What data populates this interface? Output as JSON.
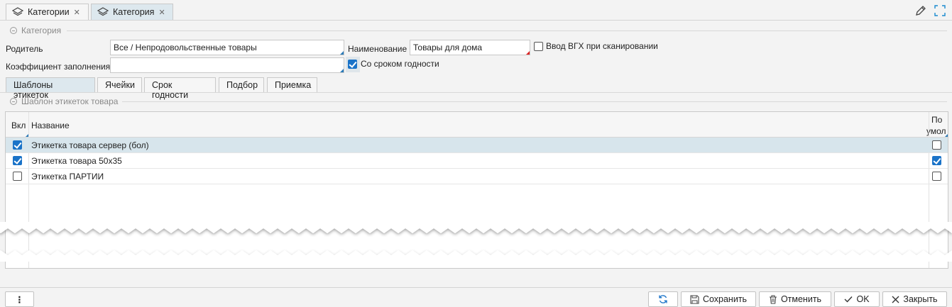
{
  "tabs": [
    {
      "label": "Категории",
      "active": false
    },
    {
      "label": "Категория",
      "active": true
    }
  ],
  "section_main": {
    "title": "Категория"
  },
  "form": {
    "parent_label": "Родитель",
    "parent_value": "Все / Непродовольственные товары",
    "name_label": "Наименование",
    "name_value": "Товары для дома",
    "vgh_label": "Ввод ВГХ при сканировании",
    "vgh_checked": false,
    "fill_label": "Коэффициент заполнения",
    "fill_value": "",
    "expiry_label": "Со сроком годности",
    "expiry_checked": true
  },
  "subtabs": [
    {
      "label": "Шаблоны этикеток",
      "active": true
    },
    {
      "label": "Ячейки",
      "active": false
    },
    {
      "label": "Срок годности",
      "active": false
    },
    {
      "label": "Подбор",
      "active": false
    },
    {
      "label": "Приемка",
      "active": false
    }
  ],
  "section_labels": {
    "title": "Шаблон этикеток товара"
  },
  "grid": {
    "columns": {
      "enabled": "Вкл",
      "name": "Название",
      "default_line1": "По",
      "default_line2": "умол"
    },
    "rows": [
      {
        "enabled": true,
        "name": "Этикетка товара сервер (бол)",
        "default": false,
        "selected": true
      },
      {
        "enabled": true,
        "name": "Этикетка товара 50х35",
        "default": true,
        "selected": false
      },
      {
        "enabled": false,
        "name": "Этикетка ПАРТИИ",
        "default": false,
        "selected": false
      }
    ]
  },
  "toolbar_icons": [
    "list-view-icon",
    "grid-view-icon",
    "filter-icon",
    "settings-icon",
    "ordered-list-icon",
    "add-row-icon",
    "export-icon",
    "sync-icon"
  ],
  "actions": {
    "menu": "⋮",
    "save": "Сохранить",
    "cancel": "Отменить",
    "ok": "OK",
    "close": "Закрыть"
  },
  "colors": {
    "accent": "#1a73c8",
    "selected_row": "#d7e5ec",
    "active_tab": "#dde8ee"
  }
}
